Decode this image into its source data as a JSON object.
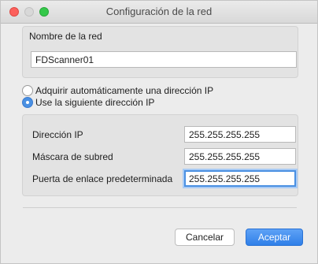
{
  "window": {
    "title": "Configuración de la red"
  },
  "network_name": {
    "label": "Nombre de la red",
    "value": "FDScanner01"
  },
  "ip_mode": {
    "auto_label": "Adquirir automáticamente una dirección IP",
    "manual_label": "Use la siguiente dirección IP",
    "selected": "manual"
  },
  "ip_settings": {
    "ip_label": "Dirección IP",
    "ip_value": "255.255.255.255",
    "mask_label": "Máscara de subred",
    "mask_value": "255.255.255.255",
    "gateway_label": "Puerta de enlace predeterminada",
    "gateway_value": "255.255.255.255"
  },
  "buttons": {
    "cancel": "Cancelar",
    "accept": "Aceptar"
  },
  "colors": {
    "accent": "#4a90e2",
    "close": "#fc605c",
    "maximize": "#34c84a"
  }
}
